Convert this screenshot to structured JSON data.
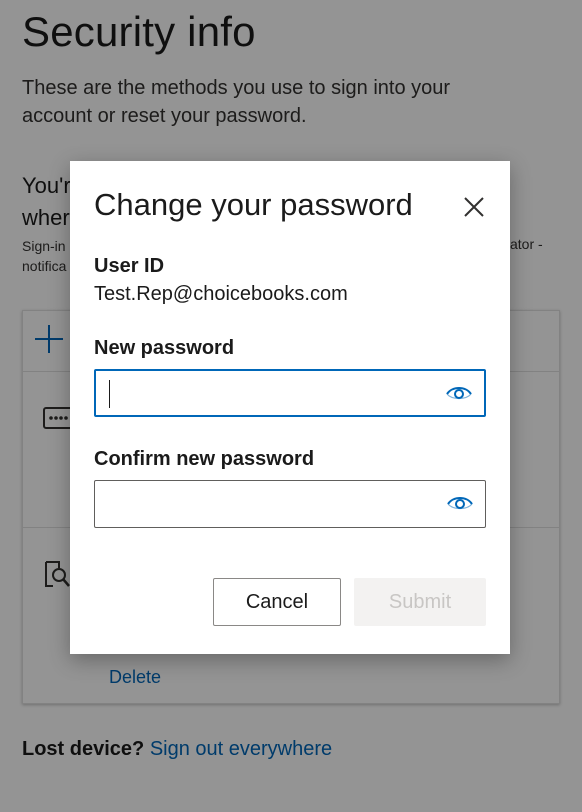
{
  "page": {
    "title": "Security info",
    "intro": "These are the methods you use to sign into your account or reset your password.",
    "partial_heading_line1": "You'r",
    "partial_heading_line2": "wher",
    "partial_small_line1": "Sign-in",
    "partial_small_line2": "notifica",
    "partial_small_right": "ator -",
    "delete_link": "Delete",
    "lost_device_label": "Lost device?",
    "sign_out_link": "Sign out everywhere"
  },
  "dialog": {
    "title": "Change your password",
    "user_id_label": "User ID",
    "user_id_value": "Test.Rep@choicebooks.com",
    "new_password_label": "New password",
    "new_password_value": "",
    "confirm_password_label": "Confirm new password",
    "confirm_password_value": "",
    "cancel_label": "Cancel",
    "submit_label": "Submit"
  },
  "colors": {
    "accent": "#0067b8",
    "overlay": "rgba(0,0,0,0.42)",
    "disabled_bg": "#f3f2f1",
    "disabled_text": "#c8c6c4"
  },
  "icons": {
    "close": "close-icon",
    "show_password": "eye-icon",
    "add": "plus-icon",
    "password_method": "password-dots-icon",
    "authenticator_method": "authenticator-key-icon"
  }
}
